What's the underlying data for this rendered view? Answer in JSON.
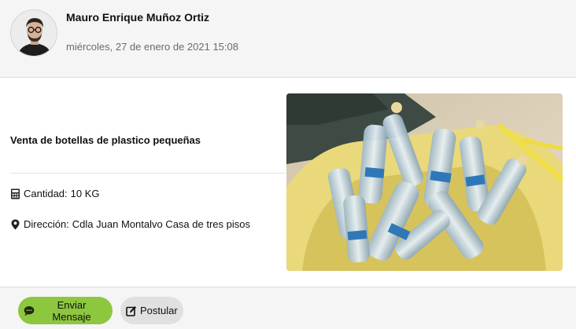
{
  "post": {
    "author_name": "Mauro Enrique Muñoz Ortiz",
    "date": "miércoles, 27 de enero de 2021 15:08",
    "title": "Venta de botellas de plastico pequeñas",
    "quantity_label": "Cantidad:",
    "quantity_value": "10 KG",
    "address_label": "Dirección:",
    "address_value": "Cdla Juan Montalvo Casa de tres pisos"
  },
  "icons": {
    "quantity": "calculator-icon",
    "address": "map-marker-icon",
    "send": "comment-icon",
    "apply": "edit-icon"
  },
  "actions": {
    "send_label": "Enviar Mensaje",
    "apply_label": "Postular"
  },
  "colors": {
    "send_button": "#8dc63f",
    "apply_button": "#e0e0e0",
    "header_bg": "#f5f5f5"
  }
}
